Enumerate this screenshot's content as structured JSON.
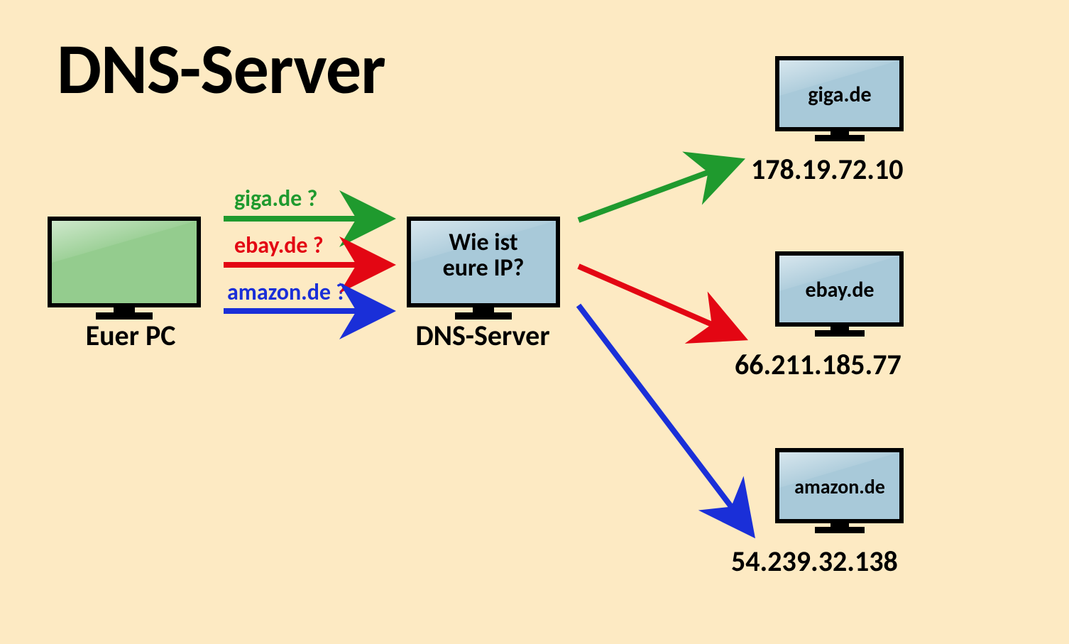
{
  "title": "DNS-Server",
  "pc": {
    "label": "Euer PC"
  },
  "dns": {
    "label": "DNS-Server",
    "question1": "Wie ist",
    "question2": "eure IP?"
  },
  "queries": {
    "top": {
      "text": "giga.de ?",
      "color": "#1f9a2e"
    },
    "mid": {
      "text": "ebay.de ?",
      "color": "#e30613"
    },
    "bot": {
      "text": "amazon.de ?",
      "color": "#1a2fd8"
    }
  },
  "servers": {
    "a": {
      "name": "giga.de",
      "ip": "178.19.72.10"
    },
    "b": {
      "name": "ebay.de",
      "ip": "66.211.185.77"
    },
    "c": {
      "name": "amazon.de",
      "ip": "54.239.32.138"
    }
  },
  "colors": {
    "screenBlue": "#a8c9d9",
    "screenGreen": "#94cc8e",
    "stroke": "#000"
  }
}
